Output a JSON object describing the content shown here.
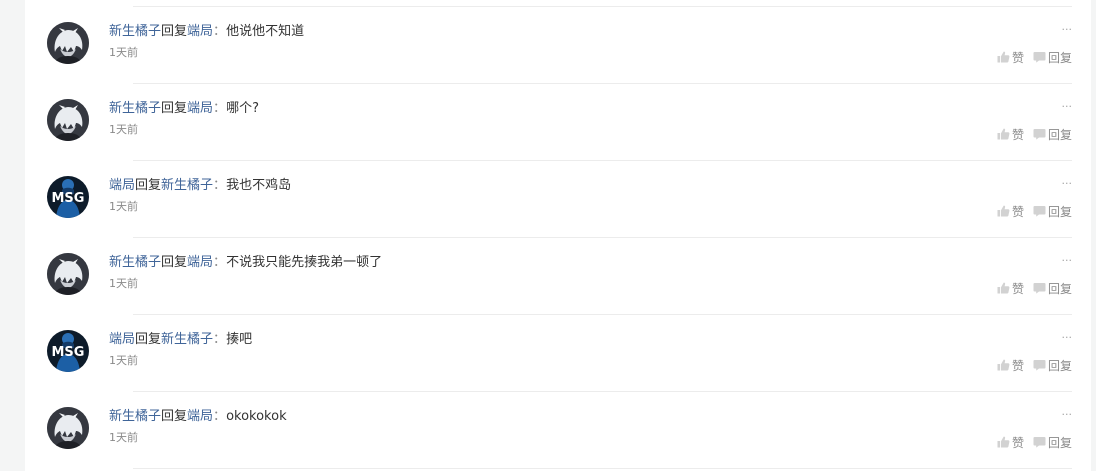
{
  "comments": [
    {
      "from": "新生橘子",
      "reply_word": "回复",
      "to": "端局",
      "colon": "：",
      "text": "他说他不知道",
      "time": "1天前",
      "like_label": "赞",
      "reply_label": "回复",
      "avatar": "white-hair-avatar",
      "more": "···"
    },
    {
      "from": "新生橘子",
      "reply_word": "回复",
      "to": "端局",
      "colon": "：",
      "text": "哪个?",
      "time": "1天前",
      "like_label": "赞",
      "reply_label": "回复",
      "avatar": "white-hair-avatar",
      "more": "···"
    },
    {
      "from": "端局",
      "reply_word": "回复",
      "to": "新生橘子",
      "colon": "：",
      "text": "我也不鸡岛",
      "time": "1天前",
      "like_label": "赞",
      "reply_label": "回复",
      "avatar": "msg-team-avatar",
      "avatar_text": "MSG",
      "more": "···"
    },
    {
      "from": "新生橘子",
      "reply_word": "回复",
      "to": "端局",
      "colon": "：",
      "text": "不说我只能先揍我弟一顿了",
      "time": "1天前",
      "like_label": "赞",
      "reply_label": "回复",
      "avatar": "white-hair-avatar",
      "more": "···"
    },
    {
      "from": "端局",
      "reply_word": "回复",
      "to": "新生橘子",
      "colon": "：",
      "text": "揍吧",
      "time": "1天前",
      "like_label": "赞",
      "reply_label": "回复",
      "avatar": "msg-team-avatar",
      "avatar_text": "MSG",
      "more": "···"
    },
    {
      "from": "新生橘子",
      "reply_word": "回复",
      "to": "端局",
      "colon": "：",
      "text": "okokokok",
      "time": "1天前",
      "like_label": "赞",
      "reply_label": "回复",
      "avatar": "white-hair-avatar",
      "more": "···"
    }
  ],
  "colors": {
    "username": "#406599",
    "meta": "#8a8a8a",
    "divider": "#ececec",
    "page_bg": "#f4f5f5"
  }
}
